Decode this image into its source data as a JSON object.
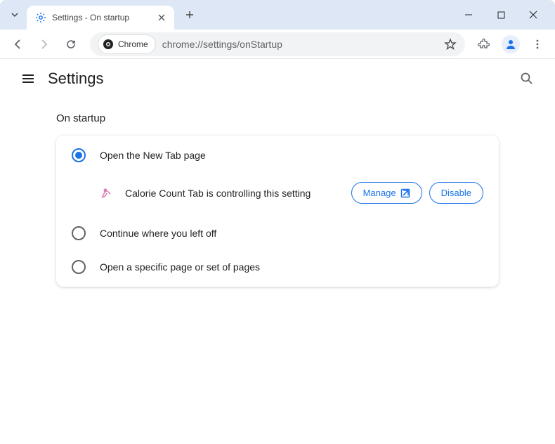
{
  "window": {
    "tab_title": "Settings - On startup"
  },
  "toolbar": {
    "chrome_label": "Chrome",
    "url": "chrome://settings/onStartup"
  },
  "header": {
    "title": "Settings"
  },
  "section": {
    "label": "On startup"
  },
  "options": {
    "new_tab": "Open the New Tab page",
    "continue": "Continue where you left off",
    "specific": "Open a specific page or set of pages"
  },
  "extension": {
    "message": "Calorie Count Tab is controlling this setting",
    "manage": "Manage",
    "disable": "Disable"
  }
}
